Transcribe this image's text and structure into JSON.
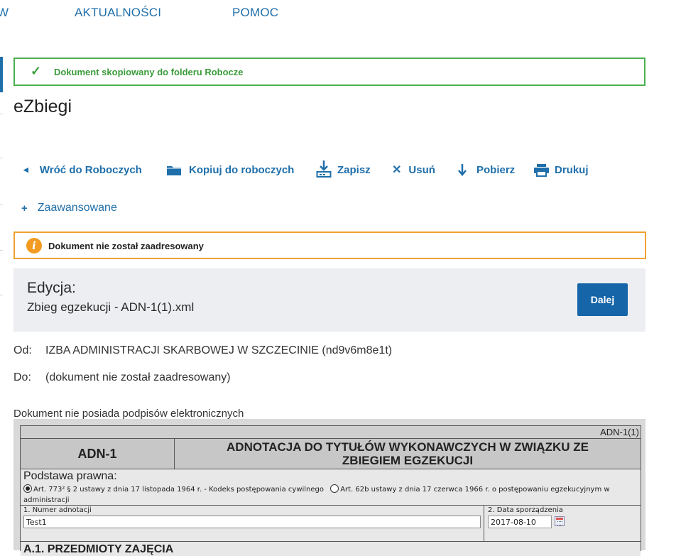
{
  "nav": {
    "partial_item": "W",
    "items": [
      "AKTUALNOŚCI",
      "POMOC"
    ]
  },
  "success": {
    "message": "Dokument skopiowany do folderu Robocze"
  },
  "page_title": "eZbiegi",
  "toolbar": {
    "back": "Wróć do Roboczych",
    "copy": "Kopiuj do roboczych",
    "save": "Zapisz",
    "delete": "Usuń",
    "download": "Pobierz",
    "print": "Drukuj"
  },
  "advanced": {
    "label": "Zaawansowane"
  },
  "warning": {
    "message": "Dokument nie został zaadresowany"
  },
  "edit": {
    "heading": "Edycja:",
    "filename": "Zbieg egzekucji - ADN-1(1).xml",
    "next_label": "Dalej"
  },
  "meta": {
    "from_label": "Od:",
    "from_value": "IZBA ADMINISTRACJI SKARBOWEJ W SZCZECINIE (nd9v6m8e1t)",
    "to_label": "Do:",
    "to_value": "(dokument nie został zaadresowany)",
    "signatures": "Dokument nie posiada podpisów elektronicznych"
  },
  "form": {
    "code": "ADN-1(1)",
    "symbol": "ADN-1",
    "title_line1": "ADNOTACJA DO TYTUŁÓW WYKONAWCZYCH W ZWIĄZKU ZE",
    "title_line2": "ZBIEGIEM EGZEKUCJI",
    "basis_label": "Podstawa prawna:",
    "basis_option1": "Art. 773² § 2 ustawy z dnia 17 listopada 1964 r. - Kodeks postępowania cywilnego",
    "basis_option2": "Art. 62b ustawy z dnia 17 czerwca 1966 r. o postępowaniu egzekucyjnym w administracji",
    "field1_label": "1. Numer adnotacji",
    "field1_value": "Test1",
    "field2_label": "2. Data sporządzenia",
    "field2_value": "2017-08-10",
    "section_a1": "A.1. PRZEDMIOTY ZAJĘCIA"
  },
  "colors": {
    "accent": "#1f6faa",
    "success": "#4caf50",
    "warning": "#f0a030",
    "button": "#1565a8"
  }
}
